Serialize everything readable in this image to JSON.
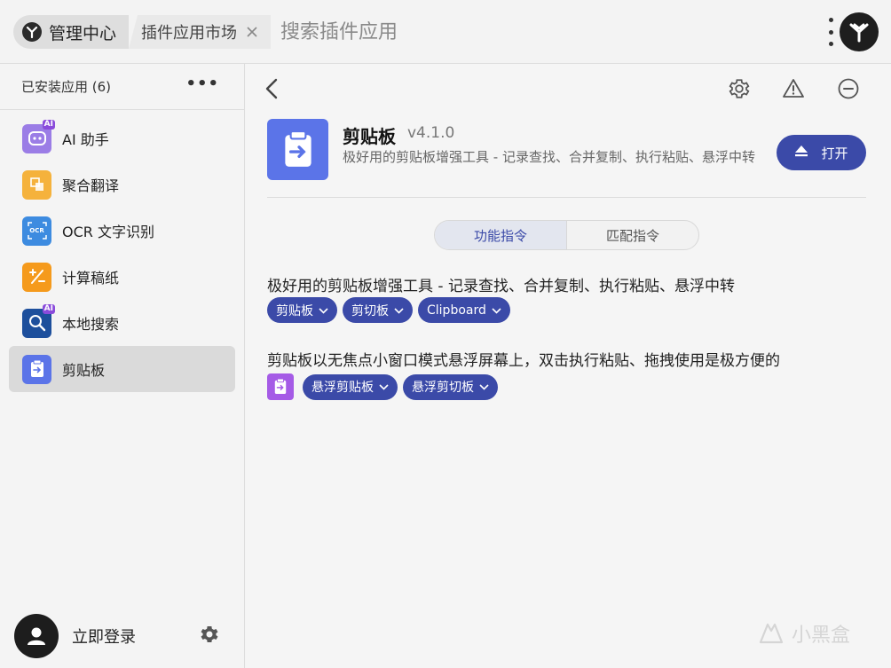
{
  "topbar": {
    "home_label": "管理中心",
    "market_label": "插件应用市场",
    "search_placeholder": "搜索插件应用"
  },
  "sidebar": {
    "title": "已安装应用 (6)",
    "items": [
      {
        "label": "AI 助手",
        "icon": "ai-robot-icon",
        "color": "#9b7de6",
        "badge": "AI"
      },
      {
        "label": "聚合翻译",
        "icon": "translate-icon",
        "color": "#f5b23c"
      },
      {
        "label": "OCR 文字识别",
        "icon": "ocr-icon",
        "color": "#3d8be0",
        "icon_text": "OCR"
      },
      {
        "label": "计算稿纸",
        "icon": "calculator-icon",
        "color": "#f59a1c"
      },
      {
        "label": "本地搜索",
        "icon": "search-icon",
        "color": "#1d4f9c",
        "badge": "AI"
      },
      {
        "label": "剪贴板",
        "icon": "clipboard-icon",
        "color": "#5b74e8"
      }
    ],
    "login_label": "立即登录"
  },
  "plugin": {
    "name": "剪贴板",
    "version": "v4.1.0",
    "description": "极好用的剪贴板增强工具 - 记录查找、合并复制、执行粘贴、悬浮中转",
    "open_label": "打开"
  },
  "tabs": [
    {
      "label": "功能指令",
      "active": true
    },
    {
      "label": "匹配指令",
      "active": false
    }
  ],
  "features": [
    {
      "description": "极好用的剪贴板增强工具 - 记录查找、合并复制、执行粘贴、悬浮中转",
      "chips": [
        "剪贴板",
        "剪切板",
        "Clipboard"
      ]
    },
    {
      "description": "剪贴板以无焦点小窗口模式悬浮屏幕上，双击执行粘贴、拖拽使用是极方便的",
      "chips": [
        "悬浮剪贴板",
        "悬浮剪切板"
      ]
    }
  ],
  "watermark": "小黑盒",
  "colors": {
    "accent": "#3b4aa8",
    "plugin_icon": "#5b74e8",
    "mini_icon": "#a55be6"
  }
}
